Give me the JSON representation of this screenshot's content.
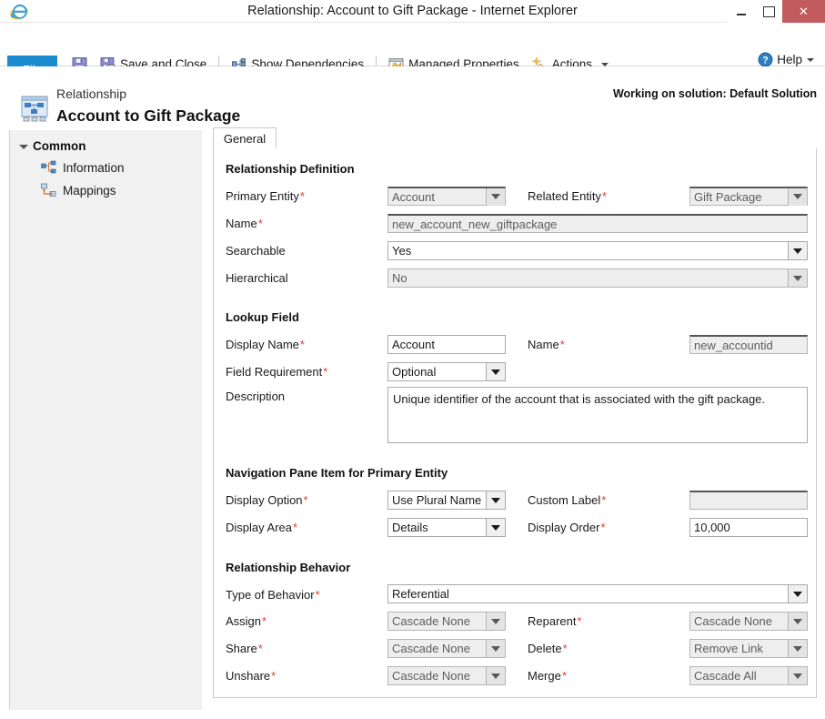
{
  "window": {
    "title": "Relationship: Account to Gift Package - Internet Explorer",
    "app_icon": "internet-explorer-icon",
    "minimize": "minimize-icon",
    "maximize": "maximize-icon",
    "close": "close-icon"
  },
  "ribbon": {
    "file_label": "File",
    "items": [
      {
        "label": "Save and Close",
        "icon": "save-and-close-icon"
      },
      {
        "label": "Show Dependencies",
        "icon": "dependencies-icon"
      },
      {
        "label": "Managed Properties",
        "icon": "managed-properties-icon"
      },
      {
        "label": "Actions",
        "icon": "actions-icon",
        "has_caret": true
      }
    ],
    "save_icon": "save-icon",
    "help_label": "Help",
    "help_icon": "help-icon"
  },
  "header": {
    "entity_type": "Relationship",
    "title": "Account to Gift Package",
    "solution": "Working on solution: Default Solution",
    "icon": "relationship-icon"
  },
  "sidebar": {
    "group_label": "Common",
    "items": [
      {
        "label": "Information",
        "icon": "information-icon"
      },
      {
        "label": "Mappings",
        "icon": "mappings-icon"
      }
    ]
  },
  "tabs": [
    {
      "label": "General",
      "selected": true
    }
  ],
  "sections": {
    "relationship_definition": {
      "title": "Relationship Definition",
      "primary_entity": {
        "label": "Primary Entity",
        "value": "Account",
        "required": true,
        "type": "select",
        "disabled": true
      },
      "related_entity": {
        "label": "Related Entity",
        "value": "Gift Package",
        "required": true,
        "type": "select",
        "disabled": true
      },
      "name": {
        "label": "Name",
        "value": "new_account_new_giftpackage",
        "required": true,
        "type": "text",
        "disabled": true
      },
      "searchable": {
        "label": "Searchable",
        "value": "Yes",
        "required": false,
        "type": "select",
        "disabled": false
      },
      "hierarchical": {
        "label": "Hierarchical",
        "value": "No",
        "required": false,
        "type": "select",
        "disabled": true
      }
    },
    "lookup_field": {
      "title": "Lookup Field",
      "display_name": {
        "label": "Display Name",
        "value": "Account",
        "required": true,
        "type": "text",
        "disabled": false
      },
      "name": {
        "label": "Name",
        "value": "new_accountid",
        "required": true,
        "type": "text",
        "disabled": true
      },
      "field_requirement": {
        "label": "Field Requirement",
        "value": "Optional",
        "required": true,
        "type": "select",
        "disabled": false
      },
      "description": {
        "label": "Description",
        "value": "Unique identifier of the account that is associated with the gift package.",
        "required": false,
        "type": "textarea",
        "disabled": false
      }
    },
    "navigation_pane": {
      "title": "Navigation Pane Item for Primary Entity",
      "display_option": {
        "label": "Display Option",
        "value": "Use Plural Name",
        "required": true,
        "type": "select",
        "disabled": false
      },
      "custom_label": {
        "label": "Custom Label",
        "value": "",
        "required": true,
        "type": "text",
        "disabled": true
      },
      "display_area": {
        "label": "Display Area",
        "value": "Details",
        "required": true,
        "type": "select",
        "disabled": false
      },
      "display_order": {
        "label": "Display Order",
        "value": "10,000",
        "required": true,
        "type": "text",
        "disabled": false
      }
    },
    "relationship_behavior": {
      "title": "Relationship Behavior",
      "type_of_behavior": {
        "label": "Type of Behavior",
        "value": "Referential",
        "required": true,
        "type": "select",
        "disabled": false
      },
      "assign": {
        "label": "Assign",
        "value": "Cascade None",
        "required": true,
        "type": "select",
        "disabled": true
      },
      "reparent": {
        "label": "Reparent",
        "value": "Cascade None",
        "required": true,
        "type": "select",
        "disabled": true
      },
      "share": {
        "label": "Share",
        "value": "Cascade None",
        "required": true,
        "type": "select",
        "disabled": true
      },
      "delete": {
        "label": "Delete",
        "value": "Remove Link",
        "required": true,
        "type": "select",
        "disabled": true
      },
      "unshare": {
        "label": "Unshare",
        "value": "Cascade None",
        "required": true,
        "type": "select",
        "disabled": true
      },
      "merge": {
        "label": "Merge",
        "value": "Cascade All",
        "required": true,
        "type": "select",
        "disabled": true
      }
    }
  },
  "colors": {
    "accent": "#1b8bd0",
    "close_button": "#c15b5d",
    "required_marker": "#e03a35",
    "sidebar_bg": "#f1f1f1"
  }
}
